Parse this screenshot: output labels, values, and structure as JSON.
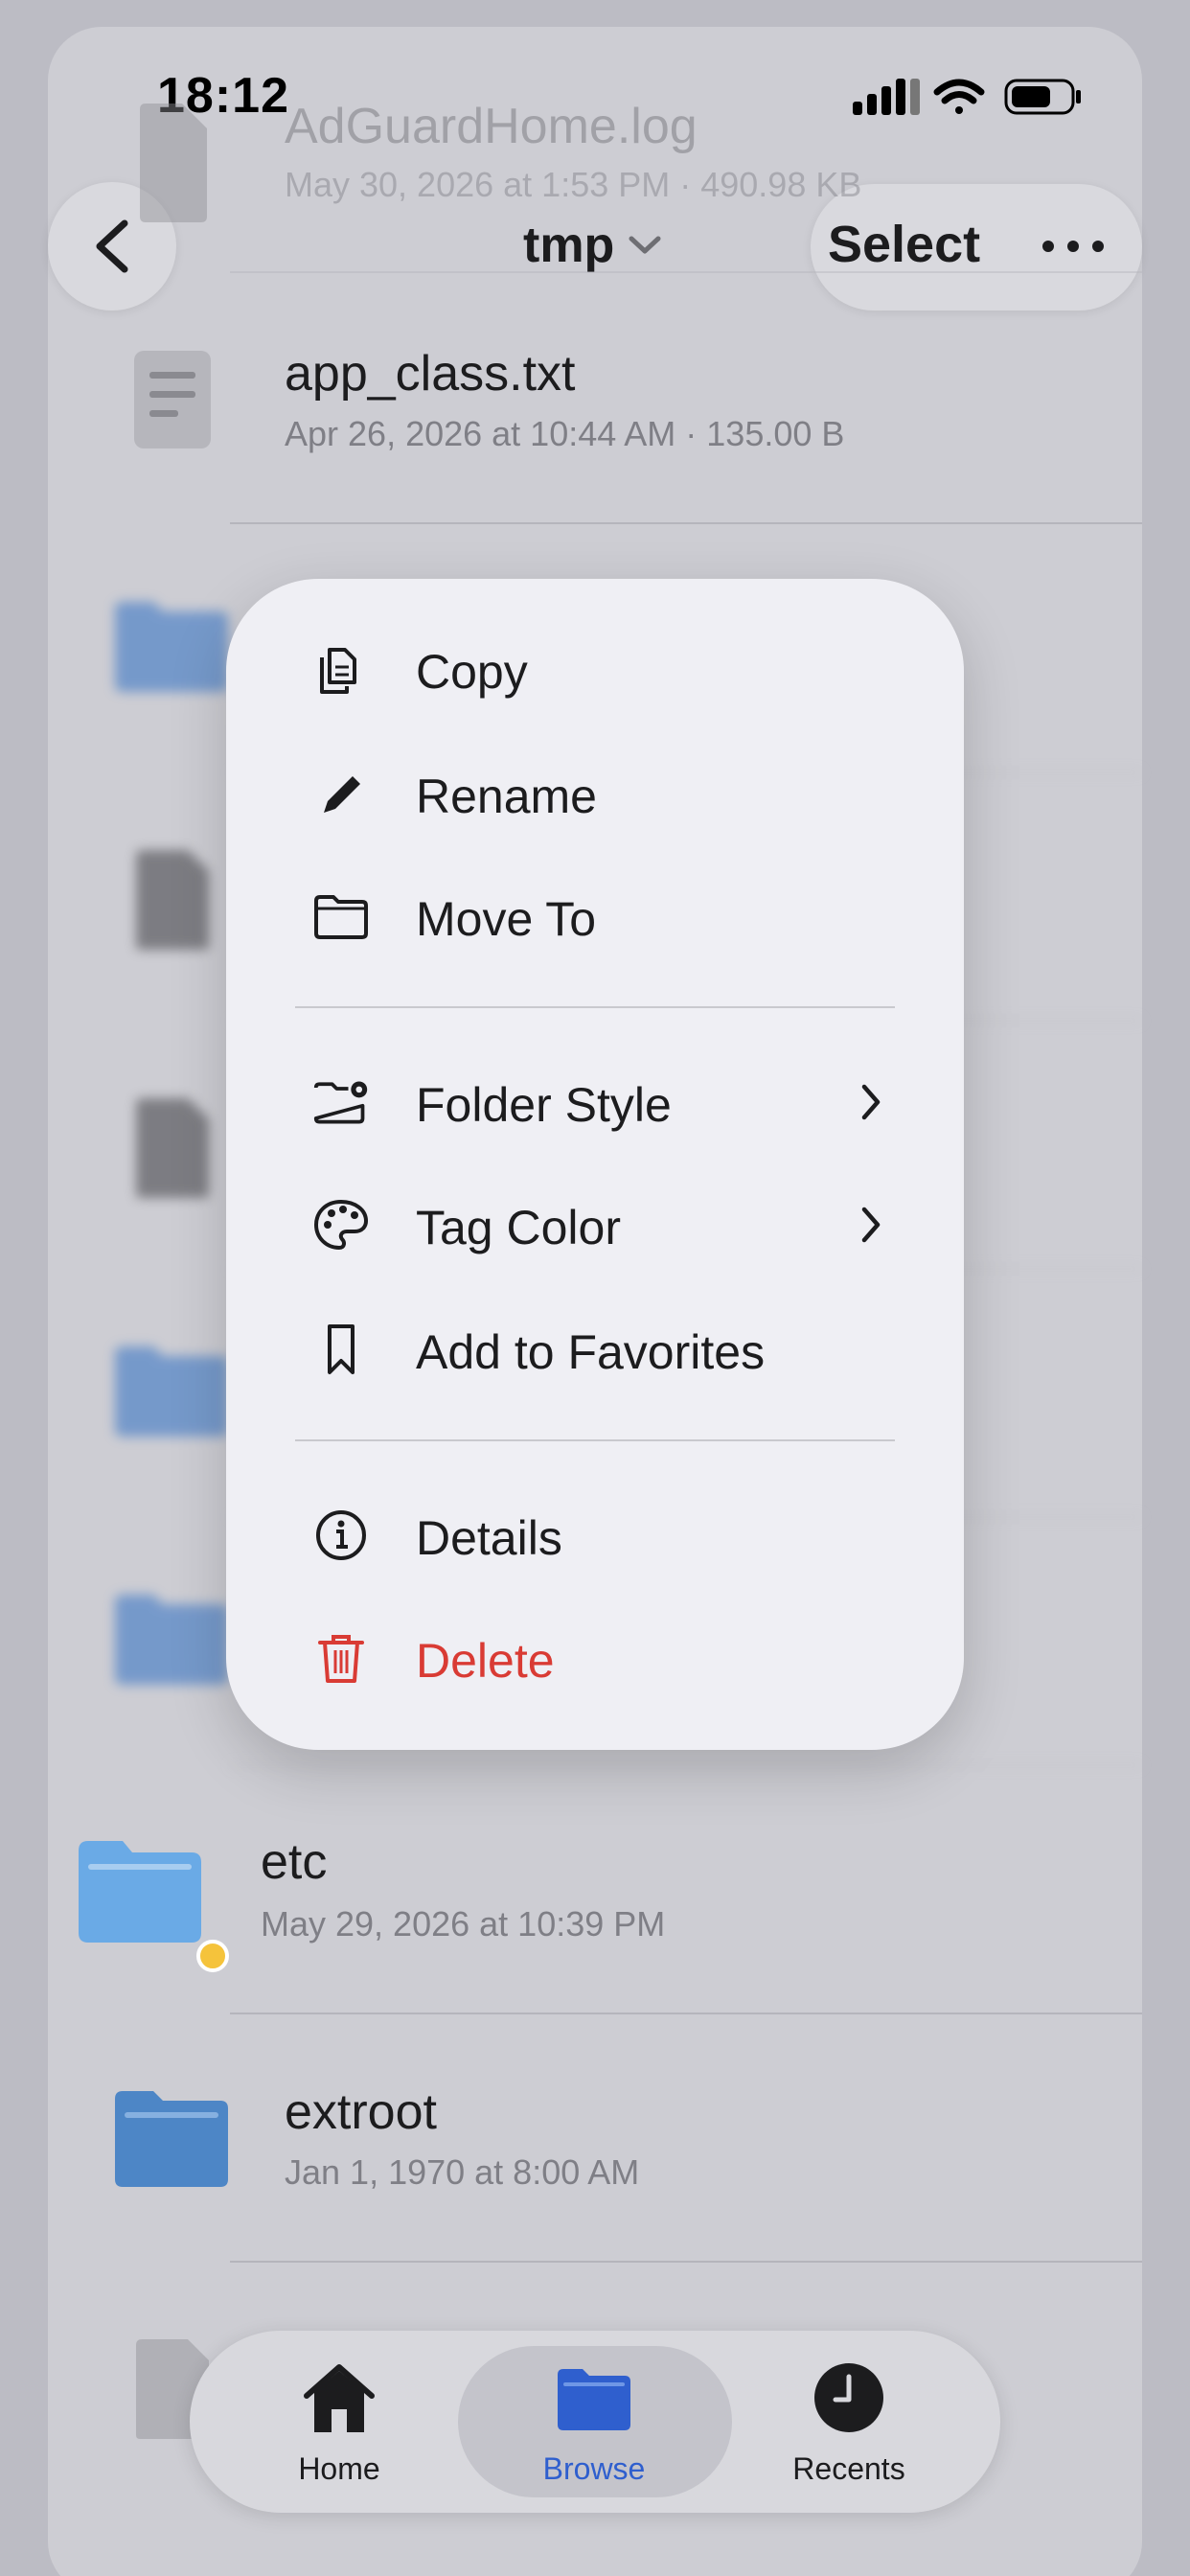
{
  "status_bar": {
    "time": "18:12"
  },
  "nav": {
    "title": "tmp",
    "select_label": "Select"
  },
  "files": [
    {
      "name": "AdGuardHome.log",
      "meta": "May 30, 2026 at 1:53 PM · 490.98 KB",
      "icon": "document-icon"
    },
    {
      "name": "app_class.txt",
      "meta": "Apr 26, 2026 at 10:44 AM · 135.00 B",
      "icon": "text-document-icon"
    },
    {
      "name": "etc",
      "meta": "May 29, 2026 at 10:39 PM",
      "icon": "folder-icon",
      "tag_color": "#f5c33b"
    },
    {
      "name": "extroot",
      "meta": "Jan 1, 1970 at 8:00 AM",
      "icon": "folder-icon"
    }
  ],
  "context_menu": {
    "items": [
      {
        "label": "Copy",
        "icon": "copy-icon"
      },
      {
        "label": "Rename",
        "icon": "pencil-icon"
      },
      {
        "label": "Move To",
        "icon": "folder-outline-icon"
      },
      {
        "label": "Folder Style",
        "icon": "folder-gear-icon",
        "submenu": true
      },
      {
        "label": "Tag Color",
        "icon": "palette-icon",
        "submenu": true
      },
      {
        "label": "Add to Favorites",
        "icon": "bookmark-icon"
      },
      {
        "label": "Details",
        "icon": "info-icon"
      },
      {
        "label": "Delete",
        "icon": "trash-icon",
        "destructive": true
      }
    ]
  },
  "tab_bar": {
    "tabs": [
      {
        "label": "Home",
        "icon": "house-icon"
      },
      {
        "label": "Browse",
        "icon": "folder-icon",
        "active": true
      },
      {
        "label": "Recents",
        "icon": "clock-icon"
      }
    ]
  },
  "colors": {
    "accent": "#2f5fce",
    "folder": "#4d86c6",
    "destructive": "#d93b34",
    "tag_yellow": "#f5c33b"
  }
}
